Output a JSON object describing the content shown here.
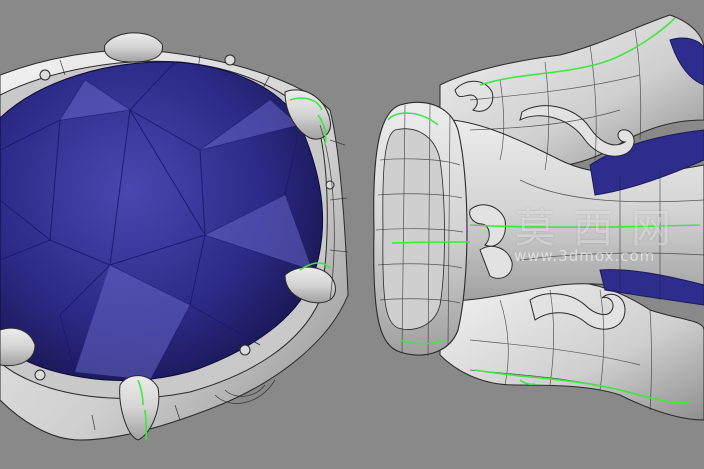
{
  "viewport": {
    "background_color": "#898989",
    "curve_highlight_color": "#3ee83e",
    "wire_color": "#1f1f1f",
    "gem_color": "#2b2a86",
    "metal_color": "#d9d9d9"
  },
  "watermark": {
    "text_cn": "莫西网",
    "url": "www.3dmox.com"
  }
}
